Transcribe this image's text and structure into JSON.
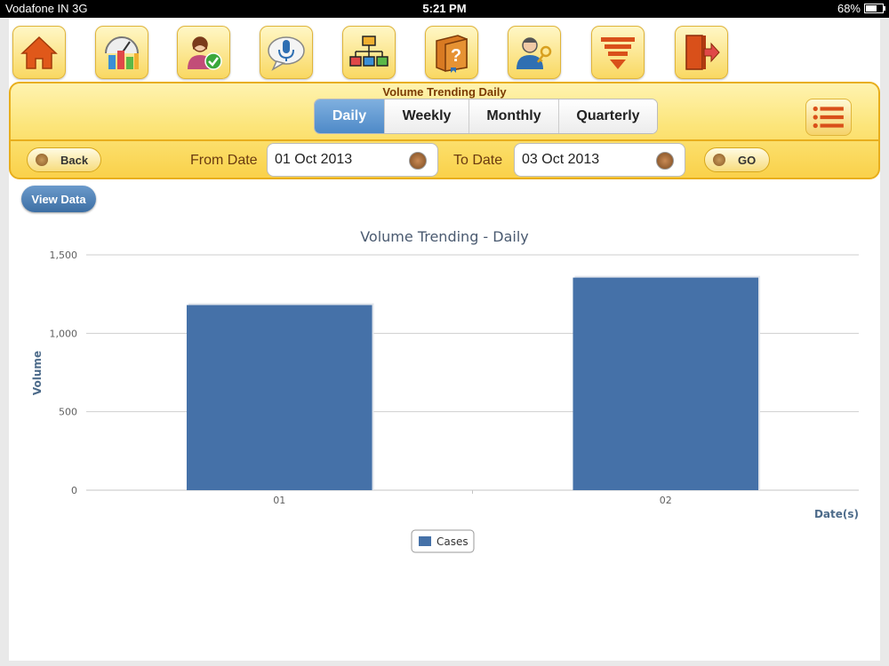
{
  "status_bar": {
    "carrier": "Vodafone IN 3G",
    "time": "5:21 PM",
    "battery": "68%",
    "battery_level": 0.68
  },
  "toolbar": {
    "icons": [
      "home-icon",
      "gauge-chart-icon",
      "user-check-icon",
      "microphone-icon",
      "org-chart-icon",
      "help-book-icon",
      "user-key-icon",
      "sort-list-icon",
      "logout-icon"
    ]
  },
  "panel": {
    "title": "Volume Trending Daily",
    "tabs": [
      {
        "label": "Daily",
        "active": true
      },
      {
        "label": "Weekly",
        "active": false
      },
      {
        "label": "Monthly",
        "active": false
      },
      {
        "label": "Quarterly",
        "active": false
      }
    ],
    "back_label": "Back",
    "from_label": "From Date",
    "from_value": "01 Oct 2013",
    "to_label": "To Date",
    "to_value": "03 Oct 2013",
    "go_label": "GO"
  },
  "view_data_label": "View Data",
  "colors": {
    "bar": "#4571a8",
    "accent": "#e8ae1c",
    "tab_active": "#5b92cf"
  },
  "chart_data": {
    "type": "bar",
    "title": "Volume Trending - Daily",
    "xlabel": "Date(s)",
    "ylabel": "Volume",
    "categories": [
      "01",
      "02"
    ],
    "series": [
      {
        "name": "Cases",
        "values": [
          1180,
          1355
        ]
      }
    ],
    "ylim": [
      0,
      1500
    ],
    "yticks": [
      0,
      500,
      1000,
      1500
    ],
    "ytick_labels": [
      "0",
      "500",
      "1,000",
      "1,500"
    ],
    "grid": true,
    "legend": "bottom-center"
  }
}
